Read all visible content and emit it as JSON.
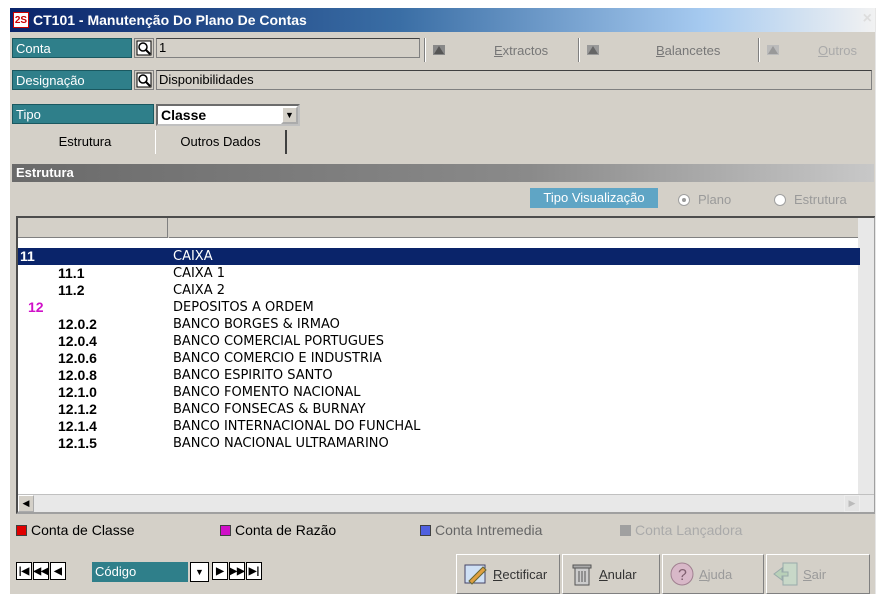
{
  "window": {
    "title": "CT101 - Manutenção Do Plano De Contas",
    "icon_text": "2S",
    "close_glyph": "×"
  },
  "fields": {
    "conta_label": "Conta",
    "conta_value": "1",
    "designacao_label": "Designação",
    "designacao_value": "Disponibilidades",
    "tipo_label": "Tipo",
    "tipo_value": "Classe"
  },
  "toolbar": {
    "extractos_ul": "E",
    "extractos_rest": "xtractos",
    "balancetes_ul": "B",
    "balancetes_rest": "alancetes",
    "outros_ul": "O",
    "outros_rest": "utros"
  },
  "tabs": {
    "estrutura": "Estrutura",
    "outros_dados": "Outros Dados"
  },
  "panel": {
    "header": "Estrutura",
    "viz_label": "Tipo Visualização",
    "radio_plano": "Plano",
    "radio_estrutura": "Estrutura"
  },
  "rows": [
    {
      "code": "11",
      "desc": "CAIXA"
    },
    {
      "code": "11.1",
      "desc": "CAIXA 1"
    },
    {
      "code": "11.2",
      "desc": "CAIXA 2"
    },
    {
      "code": "12",
      "desc": "DEPOSITOS A ORDEM"
    },
    {
      "code": "12.0.2",
      "desc": "BANCO BORGES & IRMAO"
    },
    {
      "code": "12.0.4",
      "desc": "BANCO COMERCIAL PORTUGUES"
    },
    {
      "code": "12.0.6",
      "desc": "BANCO COMERCIO E INDUSTRIA"
    },
    {
      "code": "12.0.8",
      "desc": "BANCO ESPIRITO SANTO"
    },
    {
      "code": "12.1.0",
      "desc": "BANCO FOMENTO NACIONAL"
    },
    {
      "code": "12.1.2",
      "desc": "BANCO FONSECAS & BURNAY"
    },
    {
      "code": "12.1.4",
      "desc": "BANCO INTERNACIONAL DO FUNCHAL"
    },
    {
      "code": "12.1.5",
      "desc": "BANCO NACIONAL ULTRAMARINO"
    }
  ],
  "legend": {
    "classe": "Conta de Classe",
    "razao": "Conta de Razão",
    "intermedia": "Conta Intremedia",
    "lancadora": "Conta Lançadora"
  },
  "colors": {
    "classe": "#e00000",
    "razao": "#d010c8",
    "intermedia": "#5060e0",
    "lancadora": "#a0a0a0",
    "label_bg": "#2f7f8a",
    "selection": "#0a246a"
  },
  "bottom": {
    "nav_field": "Código",
    "rectificar_ul": "R",
    "rectificar_rest": "ectificar",
    "anular_ul": "A",
    "anular_rest": "nular",
    "ajuda_ul": "A",
    "ajuda_rest": "juda",
    "sair_ul": "S",
    "sair_rest": "air"
  }
}
